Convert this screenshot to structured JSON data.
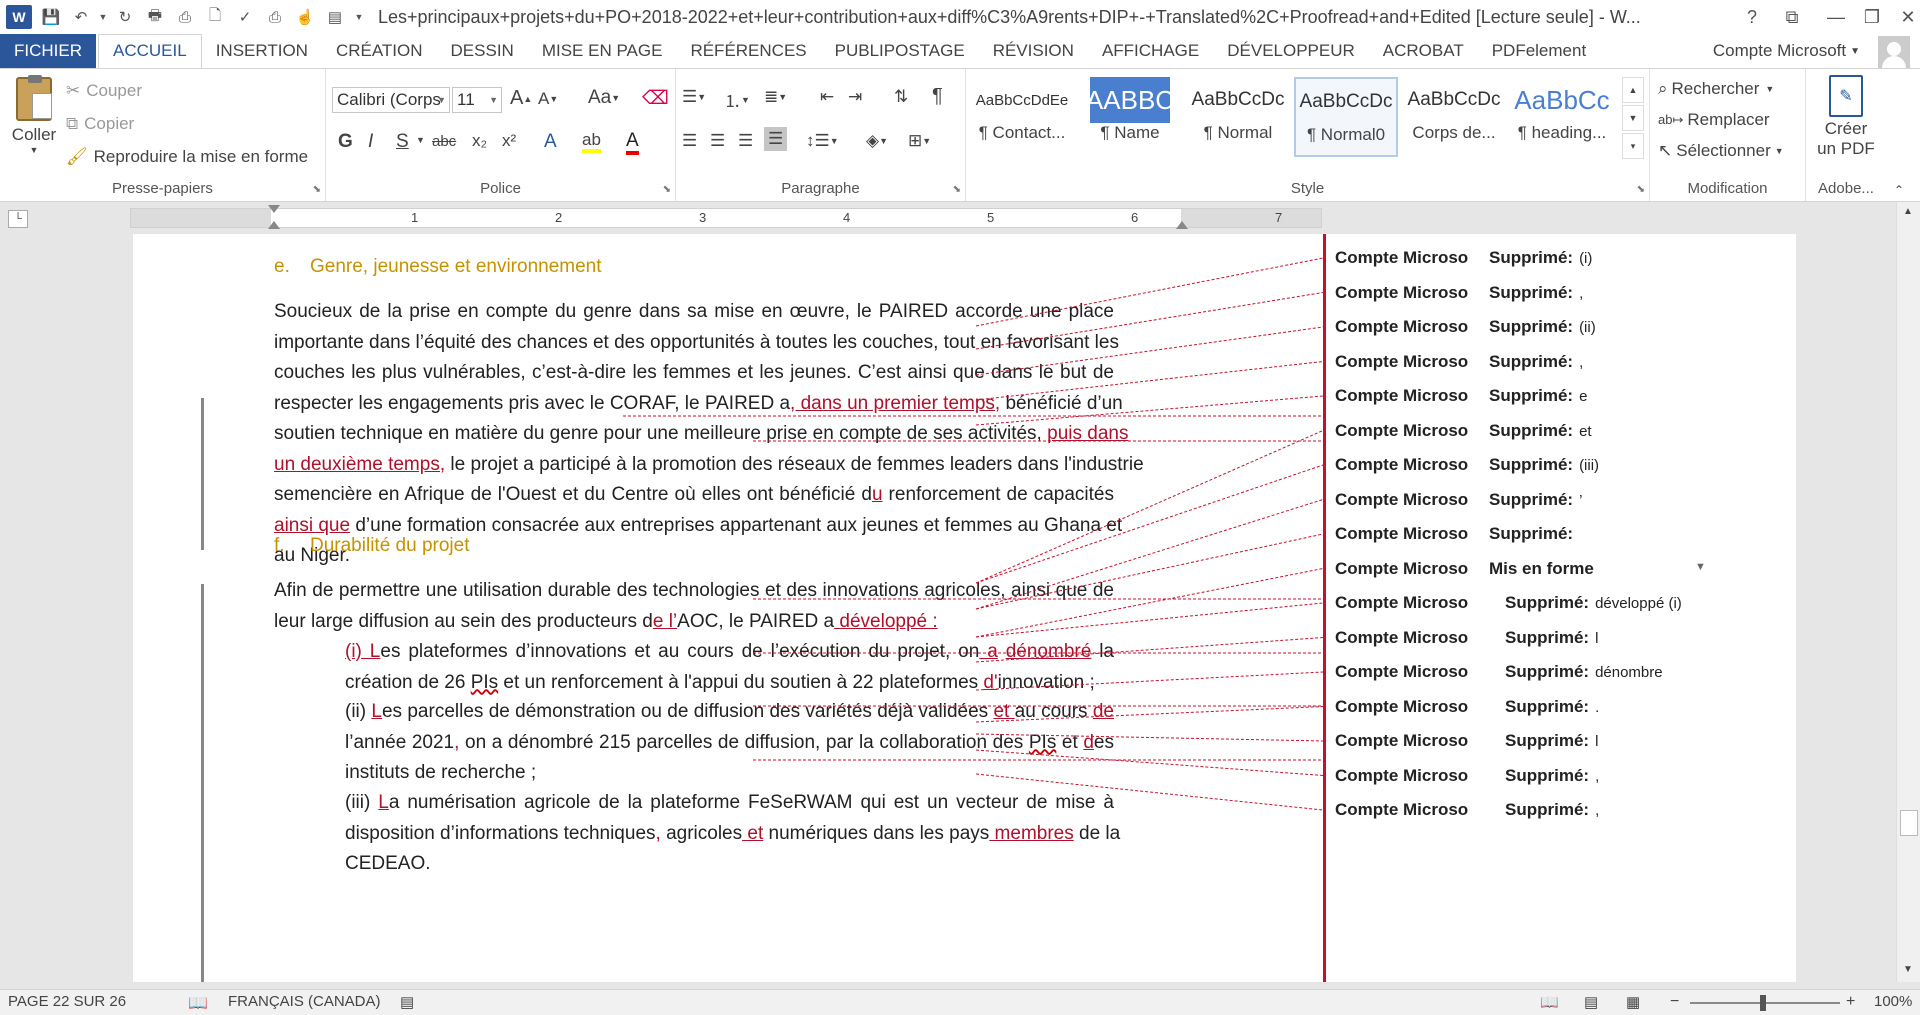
{
  "titlebar": {
    "app_icon": "word-logo-icon",
    "logo_letter": "W",
    "doc_title": "Les+principaux+projets+du+PO+2018-2022+et+leur+contribution+aux+diff%C3%A9rents+DIP+-+Translated%2C+Proofread+and+Edited [Lecture seule] - W...",
    "help": "?"
  },
  "tabs": {
    "file": "FICHIER",
    "items": [
      "ACCUEIL",
      "INSERTION",
      "CRÉATION",
      "DESSIN",
      "MISE EN PAGE",
      "RÉFÉRENCES",
      "PUBLIPOSTAGE",
      "RÉVISION",
      "AFFICHAGE",
      "DÉVELOPPEUR",
      "ACROBAT",
      "PDFelement"
    ],
    "active": "ACCUEIL",
    "account": "Compte Microsoft"
  },
  "ribbon": {
    "clipboard": {
      "paste": "Coller",
      "cut": "Couper",
      "copy": "Copier",
      "format_painter": "Reproduire la mise en forme",
      "label": "Presse-papiers"
    },
    "font": {
      "name": "Calibri (Corps",
      "size": "11",
      "change_case": "Aa",
      "bold": "G",
      "italic": "I",
      "underline": "S",
      "strike": "abc",
      "sub": "x₂",
      "sup": "x²",
      "label": "Police"
    },
    "paragraph": {
      "label": "Paragraphe"
    },
    "styles": {
      "items": [
        {
          "preview": "AaBbCcDdEe",
          "name": "¶ Contact..."
        },
        {
          "preview": "AABBC",
          "name": "¶ Name"
        },
        {
          "preview": "AaBbCcDc",
          "name": "¶ Normal"
        },
        {
          "preview": "AaBbCcDc",
          "name": "¶ Normal0"
        },
        {
          "preview": "AaBbCcDc",
          "name": "Corps de..."
        },
        {
          "preview": "AaBbCc",
          "name": "¶ heading..."
        }
      ],
      "label": "Style"
    },
    "editing": {
      "find": "Rechercher",
      "replace": "Remplacer",
      "select": "Sélectionner",
      "label": "Modification"
    },
    "adobe": {
      "create": "Créer",
      "create2": "un PDF",
      "label": "Adobe..."
    }
  },
  "ruler": {
    "numbers": [
      "1",
      "2",
      "3",
      "4",
      "5",
      "6",
      "7"
    ]
  },
  "document": {
    "heading_e": {
      "num": "e.",
      "text": "Genre, jeunesse et environnement"
    },
    "heading_f": {
      "num": "f.",
      "text": "Durabilité du projet"
    },
    "p1": [
      [
        {
          "t": "Soucieux de la prise en compte du genre dans sa mise en œuvre, le PAIRED accorde une place"
        }
      ],
      [
        {
          "t": "importante dans l’équité des chances et des opportunités à toutes les couches, tout en favorisant les"
        }
      ],
      [
        {
          "t": "couches les plus vulnérables, c’est-à-dire les femmes et les jeunes. C’est ainsi que dans le but de"
        }
      ],
      [
        {
          "t": "respecter les engagements pris avec le CORAF, le PAIRED a"
        },
        {
          "t": ", dans un premier temps,",
          "ins": true
        },
        {
          "t": " bénéficié d’un"
        }
      ],
      [
        {
          "t": "soutien technique en matière du genre pour une meilleure prise en compte de ses activités, "
        },
        {
          "t": "puis dans",
          "ins": true
        }
      ],
      [
        {
          "t": "un deuxième temps,",
          "ins": true
        },
        {
          "t": " le projet a participé à la promotion des réseaux de femmes leaders dans l'industrie"
        }
      ],
      [
        {
          "t": "semencière en Afrique de l'Ouest et du Centre où elles ont bénéficié d"
        },
        {
          "t": "u",
          "ins": true
        },
        {
          "t": " renforcement de capacités"
        }
      ],
      [
        {
          "t": "ainsi que",
          "ins": true
        },
        {
          "t": " d’une formation consacrée aux entreprises appartenant aux jeunes et femmes au Ghana et"
        }
      ],
      [
        {
          "t": "au Niger."
        }
      ]
    ],
    "p2": [
      [
        {
          "t": "Afin de permettre une utilisation durable des technologies et des innovations agricoles, ainsi que de"
        }
      ],
      [
        {
          "t": "leur large diffusion au sein des producteurs d"
        },
        {
          "t": "e l’",
          "ins": true
        },
        {
          "t": "AOC, le PAIRED a"
        },
        {
          "t": " développé :",
          "ins": true
        }
      ]
    ],
    "item1": [
      [
        {
          "t": "(i) L",
          "ins": true
        },
        {
          "t": "es plateformes d’innovations et au cours de l’exécution du projet, on"
        },
        {
          "t": " a",
          "ins": true
        },
        {
          "t": " "
        },
        {
          "t": "dénombré",
          "ins": true
        },
        {
          "t": " la"
        }
      ],
      [
        {
          "t": "création de 26 "
        },
        {
          "t": "PIs",
          "err": true
        },
        {
          "t": " et un renforcement à l'appui du soutien à 22 plateformes "
        },
        {
          "t": "d'",
          "ins": true
        },
        {
          "t": "innovation ;"
        }
      ]
    ],
    "item2": [
      [
        {
          "t": "(ii) "
        },
        {
          "t": "L",
          "ins": true
        },
        {
          "t": "es parcelles de démonstration ou de diffusion des variétés déjà validées "
        },
        {
          "t": "et ",
          "ins": true
        },
        {
          "t": "au cours "
        },
        {
          "t": "de",
          "ins": true
        }
      ],
      [
        {
          "t": "l’année 2021"
        },
        {
          "t": ",",
          "ins": true
        },
        {
          "t": " on a dénombré 215 parcelles de diffusion, par la collaboration des "
        },
        {
          "t": "PIs",
          "err": true
        },
        {
          "t": " et "
        },
        {
          "t": "d",
          "ins": true
        },
        {
          "t": "es"
        }
      ],
      [
        {
          "t": "instituts de recherche ;"
        }
      ]
    ],
    "item3": [
      [
        {
          "t": "(iii) "
        },
        {
          "t": "L",
          "ins": true
        },
        {
          "t": "a numérisation agricole de la plateforme FeSeRWAM qui est un vecteur de mise à"
        }
      ],
      [
        {
          "t": "disposition d’informations techniques"
        },
        {
          "t": ",",
          "ins": true
        },
        {
          "t": " agricoles"
        },
        {
          "t": " et",
          "ins": true
        },
        {
          "t": " numériques dans les pays"
        },
        {
          "t": " membres",
          "ins": true
        },
        {
          "t": " de la"
        }
      ],
      [
        {
          "t": "CEDEAO."
        }
      ]
    ]
  },
  "markup": [
    {
      "who": "Compte Microso",
      "kind": "Supprimé:",
      "detail": "(i)"
    },
    {
      "who": "Compte Microso",
      "kind": "Supprimé:",
      "detail": ","
    },
    {
      "who": "Compte Microso",
      "kind": "Supprimé:",
      "detail": "(ii)"
    },
    {
      "who": "Compte Microso",
      "kind": "Supprimé:",
      "detail": ","
    },
    {
      "who": "Compte Microso",
      "kind": "Supprimé:",
      "detail": "e"
    },
    {
      "who": "Compte Microso",
      "kind": "Supprimé:",
      "detail": "et"
    },
    {
      "who": "Compte Microso",
      "kind": "Supprimé:",
      "detail": "(iii)"
    },
    {
      "who": "Compte Microso",
      "kind": "Supprimé:",
      "detail": "’"
    },
    {
      "who": "Compte Microso",
      "kind": "Supprimé:",
      "detail": ""
    },
    {
      "who": "Compte Microso",
      "kind": "Mis en forme",
      "detail": ""
    },
    {
      "who": "Compte Microso",
      "kind": "Supprimé:",
      "detail": "développé  (i)"
    },
    {
      "who": "Compte Microso",
      "kind": "Supprimé:",
      "detail": "l"
    },
    {
      "who": "Compte Microso",
      "kind": "Supprimé:",
      "detail": "dénombre"
    },
    {
      "who": "Compte Microso",
      "kind": "Supprimé:",
      "detail": "."
    },
    {
      "who": "Compte Microso",
      "kind": "Supprimé:",
      "detail": "l"
    },
    {
      "who": "Compte Microso",
      "kind": "Supprimé:",
      "detail": ","
    },
    {
      "who": "Compte Microso",
      "kind": "Supprimé:",
      "detail": ","
    }
  ],
  "status": {
    "page": "PAGE 22 SUR 26",
    "language": "FRANÇAIS (CANADA)",
    "zoom": "100%"
  },
  "colors": {
    "brand": "#2b579a",
    "revision": "#c8102e",
    "heading": "#c69300"
  }
}
